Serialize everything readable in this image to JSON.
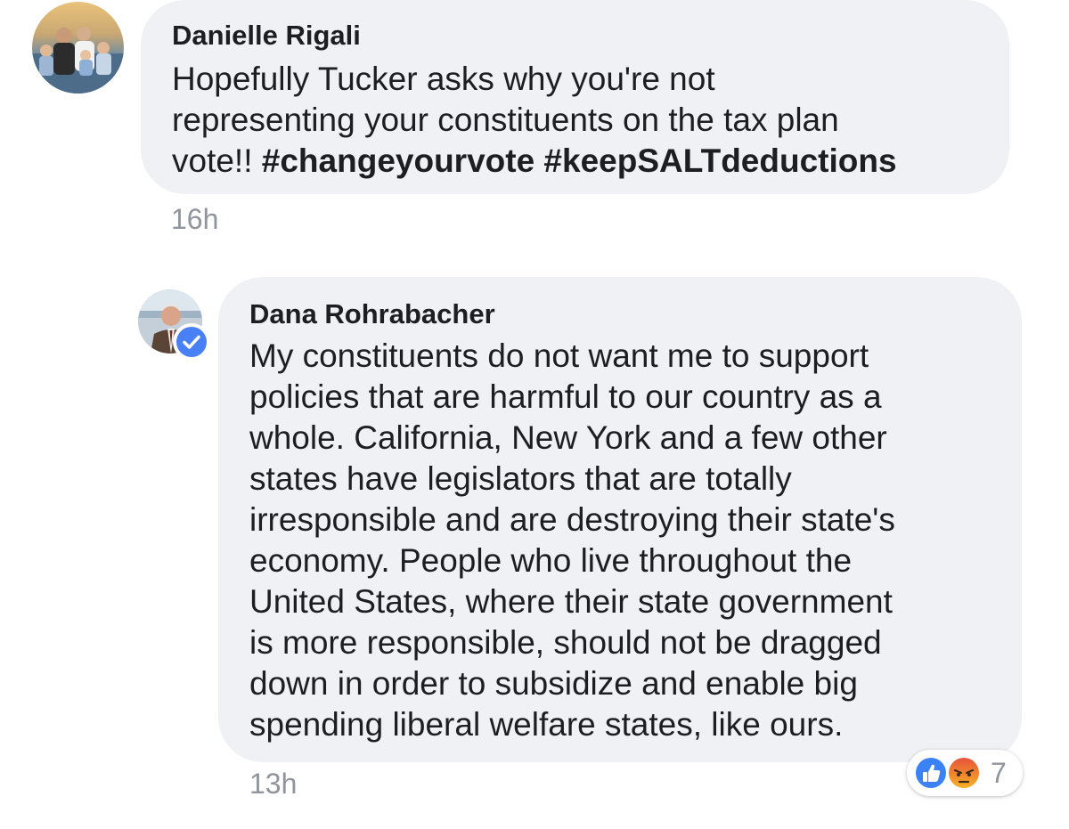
{
  "comments": [
    {
      "author": "Danielle Rigali",
      "text": "Hopefully Tucker asks why you're not\nrepresenting your constituents on the tax plan\nvote!! ",
      "hashtags": "#changeyourvote #keepSALTdeductions",
      "timestamp": "16h"
    },
    {
      "author": "Dana Rohrabacher",
      "verified": true,
      "text": "My constituents do not want me to support\npolicies that are harmful to our country as a\nwhole.  California, New York and a few other\nstates have legislators that are totally\nirresponsible and are destroying their state's\neconomy.  People who live throughout the\nUnited States, where their state government\nis more responsible, should not be dragged\ndown in order to subsidize and enable big\nspending liberal welfare states, like ours.",
      "timestamp": "13h",
      "reactions": {
        "icons": [
          "like-icon",
          "angry-icon"
        ],
        "count": "7"
      }
    }
  ],
  "colors": {
    "bubble": "#f0f1f4",
    "timestamp": "#90949c",
    "like_blue": "#3b82f6",
    "verified_blue": "#4a80f5",
    "angry_red": "#e8533a",
    "angry_yellow": "#f7b125"
  }
}
